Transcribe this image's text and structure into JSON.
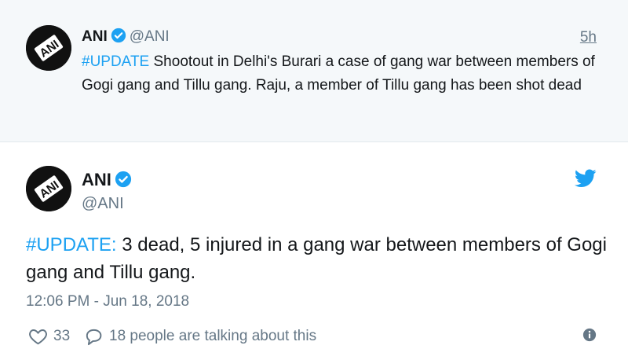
{
  "parent_tweet": {
    "name": "ANI",
    "handle": "@ANI",
    "time": "5h",
    "hashtag": "#UPDATE",
    "text": " Shootout in Delhi's Burari a case of gang war between members of Gogi gang and Tillu gang. Raju, a member of Tillu gang has been shot dead"
  },
  "main_tweet": {
    "name": "ANI",
    "handle": "@ANI",
    "hashtag": "#UPDATE:",
    "text": " 3 dead, 5 injured in a gang war between members of Gogi gang and Tillu gang.",
    "date": "12:06 PM - Jun 18, 2018",
    "likes": "33",
    "talking": "18 people are talking about this"
  },
  "icons": {
    "verified": "verified-badge-icon",
    "twitter": "twitter-bird-icon",
    "like": "heart-icon",
    "reply": "speech-bubble-icon",
    "info": "info-icon"
  },
  "colors": {
    "accent": "#1da1f2",
    "muted": "#657786",
    "parent_bg": "#f5f8fa",
    "text": "#14171a"
  },
  "avatar_text": "ANI"
}
